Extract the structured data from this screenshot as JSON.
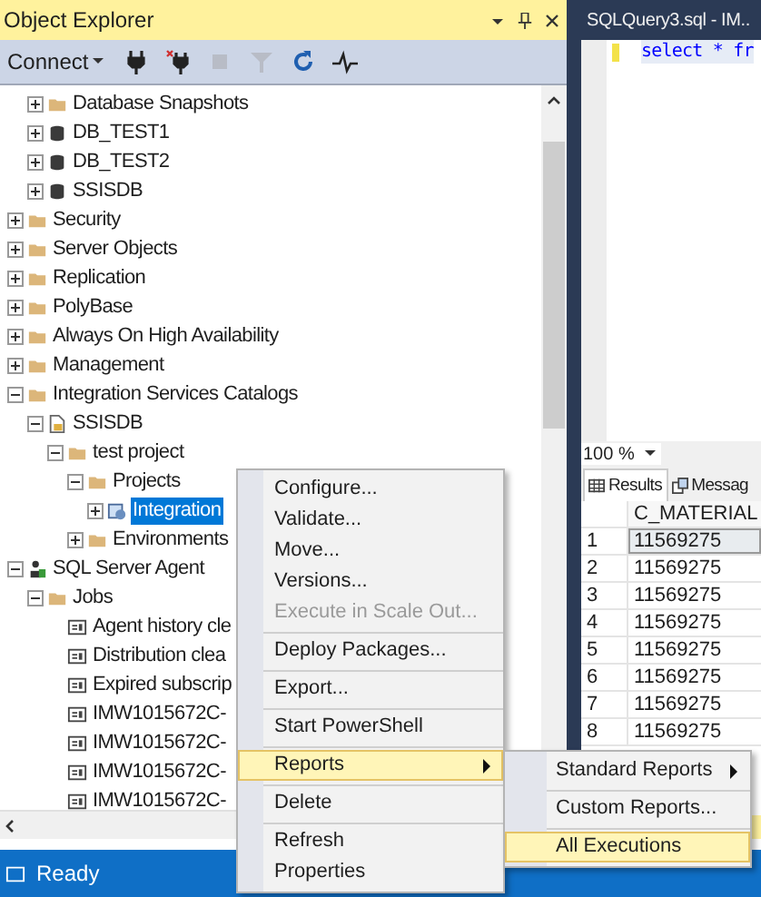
{
  "panel": {
    "title": "Object Explorer",
    "connect": "Connect"
  },
  "tree": {
    "continued": [
      {
        "label": "Database Snapshots",
        "kind": "folder",
        "expanded": false,
        "selected": false
      },
      {
        "label": "DB_TEST1",
        "kind": "database",
        "expanded": false,
        "selected": false
      },
      {
        "label": "DB_TEST2",
        "kind": "database",
        "expanded": false,
        "selected": false
      },
      {
        "label": "SSISDB",
        "kind": "database",
        "expanded": false,
        "selected": false
      }
    ],
    "nodes": [
      {
        "label": "Security",
        "kind": "folder",
        "expanded": false,
        "selected": false
      },
      {
        "label": "Server Objects",
        "kind": "folder",
        "expanded": false,
        "selected": false
      },
      {
        "label": "Replication",
        "kind": "folder",
        "expanded": false,
        "selected": false
      },
      {
        "label": "PolyBase",
        "kind": "folder",
        "expanded": false,
        "selected": false
      },
      {
        "label": "Always On High Availability",
        "kind": "folder",
        "expanded": false,
        "selected": false
      },
      {
        "label": "Management",
        "kind": "folder",
        "expanded": false,
        "selected": false
      },
      {
        "label": "Integration Services Catalogs",
        "kind": "folder",
        "expanded": true,
        "selected": false,
        "children": [
          {
            "label": "SSISDB",
            "kind": "catalog",
            "expanded": true,
            "selected": false,
            "children": [
              {
                "label": "test project",
                "kind": "folder",
                "expanded": true,
                "selected": false,
                "children": [
                  {
                    "label": "Projects",
                    "kind": "folder",
                    "expanded": true,
                    "selected": false,
                    "children": [
                      {
                        "label": "Integration",
                        "kind": "project",
                        "expanded": false,
                        "selected": true
                      }
                    ]
                  },
                  {
                    "label": "Environments",
                    "kind": "folder",
                    "expanded": false,
                    "selected": false
                  }
                ]
              }
            ]
          }
        ]
      },
      {
        "label": "SQL Server Agent",
        "kind": "agent",
        "expanded": true,
        "selected": false,
        "children": [
          {
            "label": "Jobs",
            "kind": "folder",
            "expanded": true,
            "selected": false,
            "children": [
              {
                "label": "Agent history cle",
                "kind": "job",
                "selected": false
              },
              {
                "label": "Distribution clea",
                "kind": "job",
                "selected": false
              },
              {
                "label": "Expired subscrip",
                "kind": "job",
                "selected": false
              },
              {
                "label": "IMW1015672C-",
                "kind": "job",
                "selected": false
              },
              {
                "label": "IMW1015672C-",
                "kind": "job",
                "selected": false
              },
              {
                "label": "IMW1015672C-",
                "kind": "job",
                "selected": false
              },
              {
                "label": "IMW1015672C-",
                "kind": "job",
                "selected": false
              }
            ]
          }
        ]
      }
    ]
  },
  "editor": {
    "tab": "SQLQuery3.sql - IM..",
    "code": "select * fr",
    "zoom": "100 %"
  },
  "results": {
    "tabs": [
      {
        "label": "Results",
        "kind": "grid",
        "selected": true
      },
      {
        "label": "Messag",
        "kind": "messages",
        "selected": false
      }
    ],
    "column": "C_MATERIAL",
    "rows": [
      {
        "n": "1",
        "value": "11569275",
        "selected": true
      },
      {
        "n": "2",
        "value": "11569275",
        "selected": false
      },
      {
        "n": "3",
        "value": "11569275",
        "selected": false
      },
      {
        "n": "4",
        "value": "11569275",
        "selected": false
      },
      {
        "n": "5",
        "value": "11569275",
        "selected": false
      },
      {
        "n": "6",
        "value": "11569275",
        "selected": false
      },
      {
        "n": "7",
        "value": "11569275",
        "selected": false
      },
      {
        "n": "8",
        "value": "11569275",
        "selected": false
      }
    ]
  },
  "context_menu": [
    {
      "label": "Configure...",
      "disabled": false,
      "selected": false,
      "submenu": false,
      "separator_after": false
    },
    {
      "label": "Validate...",
      "disabled": false,
      "selected": false,
      "submenu": false,
      "separator_after": false
    },
    {
      "label": "Move...",
      "disabled": false,
      "selected": false,
      "submenu": false,
      "separator_after": false
    },
    {
      "label": "Versions...",
      "disabled": false,
      "selected": false,
      "submenu": false,
      "separator_after": false
    },
    {
      "label": "Execute in Scale Out...",
      "disabled": true,
      "selected": false,
      "submenu": false,
      "separator_after": true
    },
    {
      "label": "Deploy Packages...",
      "disabled": false,
      "selected": false,
      "submenu": false,
      "separator_after": true
    },
    {
      "label": "Export...",
      "disabled": false,
      "selected": false,
      "submenu": false,
      "separator_after": true
    },
    {
      "label": "Start PowerShell",
      "disabled": false,
      "selected": false,
      "submenu": false,
      "separator_after": true
    },
    {
      "label": "Reports",
      "disabled": false,
      "selected": true,
      "submenu": true,
      "separator_after": true
    },
    {
      "label": "Delete",
      "disabled": false,
      "selected": false,
      "submenu": false,
      "separator_after": true
    },
    {
      "label": "Refresh",
      "disabled": false,
      "selected": false,
      "submenu": false,
      "separator_after": false
    },
    {
      "label": "Properties",
      "disabled": false,
      "selected": false,
      "submenu": false,
      "separator_after": false
    }
  ],
  "submenu": [
    {
      "label": "Standard Reports",
      "disabled": false,
      "selected": false,
      "submenu": true,
      "separator_after": true
    },
    {
      "label": "Custom Reports...",
      "disabled": false,
      "selected": false,
      "submenu": false,
      "separator_after": true
    },
    {
      "label": "All Executions",
      "disabled": false,
      "selected": true,
      "submenu": false,
      "separator_after": false
    }
  ],
  "status_bar": {
    "text": "Ready"
  }
}
